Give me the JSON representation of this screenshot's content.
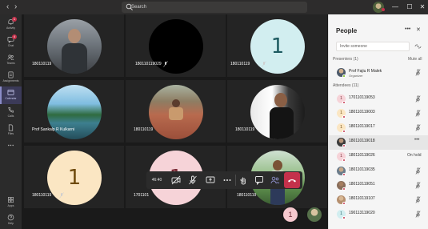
{
  "search": {
    "placeholder": "Search"
  },
  "window": {
    "nav_back": "‹",
    "nav_forward": "›",
    "more": "…",
    "minimize": "—",
    "maximize": "☐",
    "close": "✕"
  },
  "rail": {
    "items": [
      {
        "label": "Activity",
        "icon": "bell-icon",
        "badge": "1"
      },
      {
        "label": "Chat",
        "icon": "chat-icon",
        "badge": "4"
      },
      {
        "label": "Teams",
        "icon": "teams-icon",
        "badge": ""
      },
      {
        "label": "Assignments",
        "icon": "assignments-icon",
        "badge": ""
      },
      {
        "label": "Calendar",
        "icon": "calendar-icon",
        "badge": ""
      },
      {
        "label": "Calls",
        "icon": "phone-icon",
        "badge": ""
      },
      {
        "label": "Files",
        "icon": "file-icon",
        "badge": ""
      },
      {
        "label": "",
        "icon": "more-icon",
        "badge": ""
      },
      {
        "label": "Apps",
        "icon": "apps-icon",
        "badge": ""
      },
      {
        "label": "Help",
        "icon": "help-icon",
        "badge": ""
      }
    ]
  },
  "tiles": [
    {
      "name": "180110119",
      "style": "photo-portrait-dark",
      "num": ""
    },
    {
      "name": "180110119029",
      "style": "black",
      "num": ""
    },
    {
      "name": "180110119",
      "style": "cyan",
      "num": "1"
    },
    {
      "name": "Prof Sankalp R Kulkarni",
      "style": "photo-lake",
      "num": ""
    },
    {
      "name": "180110119",
      "style": "photo-steps",
      "num": ""
    },
    {
      "name": "180110119",
      "style": "photo-studio",
      "num": ""
    },
    {
      "name": "180110119",
      "style": "cream",
      "num": "1"
    },
    {
      "name": "1701101",
      "style": "pink",
      "num": "1"
    },
    {
      "name": "180110119",
      "style": "photo-outdoor",
      "num": ""
    }
  ],
  "callbar": {
    "timer": "46:40"
  },
  "raised_number": "1",
  "panel": {
    "title": "People",
    "invite_placeholder": "Invite someone",
    "presenters_label": "Presenters (1)",
    "mute_all": "Mute all",
    "attendees_label": "Attendees (11)",
    "presenters": [
      {
        "name": "Prof Fajiu R Malek",
        "role": "Organizer"
      }
    ],
    "attendees": [
      {
        "name": "170110119053",
        "avatar": "1",
        "color": "#f6d3d8",
        "fg": "#7a2b36",
        "status": "mic"
      },
      {
        "name": "180110119003",
        "avatar": "1",
        "color": "#fbe6c3",
        "fg": "#6e4a0c",
        "status": "mic"
      },
      {
        "name": "180110119017",
        "avatar": "1",
        "color": "#fbe6c3",
        "fg": "#6e4a0c",
        "status": "mic"
      },
      {
        "name": "180110119018",
        "avatar": "",
        "color": "#3b3b3b",
        "fg": "#ffffff",
        "status": "more"
      },
      {
        "name": "180110119026",
        "avatar": "1",
        "color": "#f6d3d8",
        "fg": "#7a2b36",
        "status": "hold",
        "hold": "On hold"
      },
      {
        "name": "180110119035",
        "avatar": "",
        "color": "#6b7c8a",
        "fg": "#ffffff",
        "status": "mic"
      },
      {
        "name": "180110119051",
        "avatar": "",
        "color": "#8a6e5a",
        "fg": "#ffffff",
        "status": "mic"
      },
      {
        "name": "180110119107",
        "avatar": "",
        "color": "#b58f6e",
        "fg": "#ffffff",
        "status": "mic"
      },
      {
        "name": "190113119020",
        "avatar": "1",
        "color": "#d2eef0",
        "fg": "#1d5a60",
        "status": "mic"
      }
    ]
  }
}
